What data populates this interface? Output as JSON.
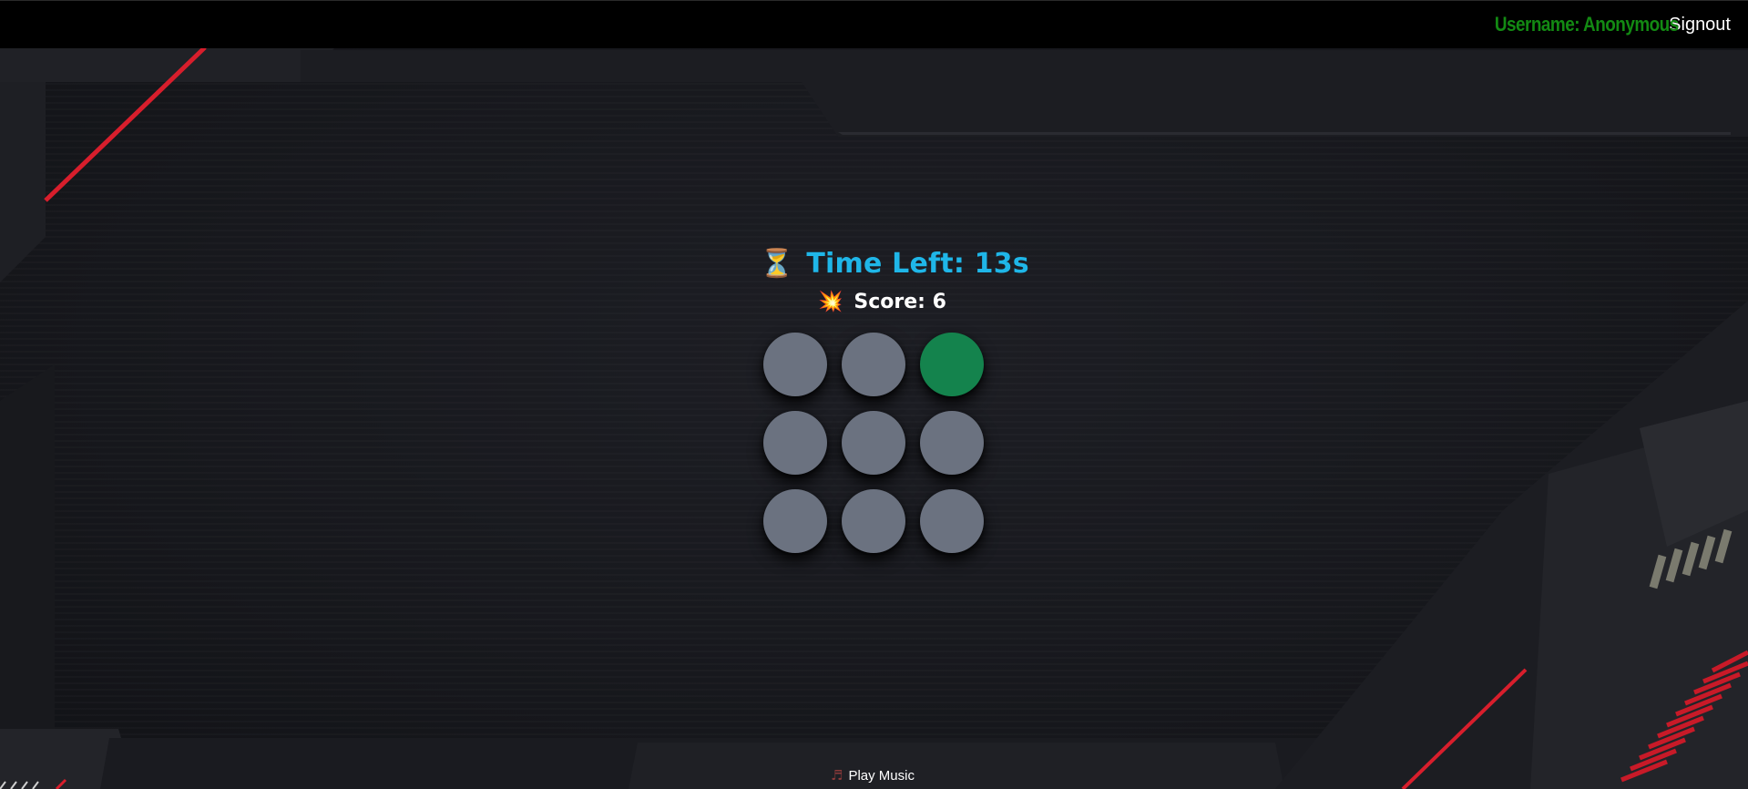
{
  "nav": {
    "username_label": "Username: Anonymous",
    "signout_label": "Signout"
  },
  "game": {
    "timer_icon": "⏳",
    "time_left_label": "Time Left: 13s",
    "score_icon": "💥",
    "score_label": "Score: 6",
    "holes": [
      {
        "active": false
      },
      {
        "active": false
      },
      {
        "active": true
      },
      {
        "active": false
      },
      {
        "active": false
      },
      {
        "active": false
      },
      {
        "active": false
      },
      {
        "active": false
      },
      {
        "active": false
      }
    ]
  },
  "music": {
    "icon": "♬",
    "label": "Play Music"
  },
  "colors": {
    "username": "#138a13",
    "timer": "#1fb6e8",
    "hole_idle": "#6b7280",
    "hole_active": "#14834d",
    "accent_stripe": "#d81e2c"
  }
}
